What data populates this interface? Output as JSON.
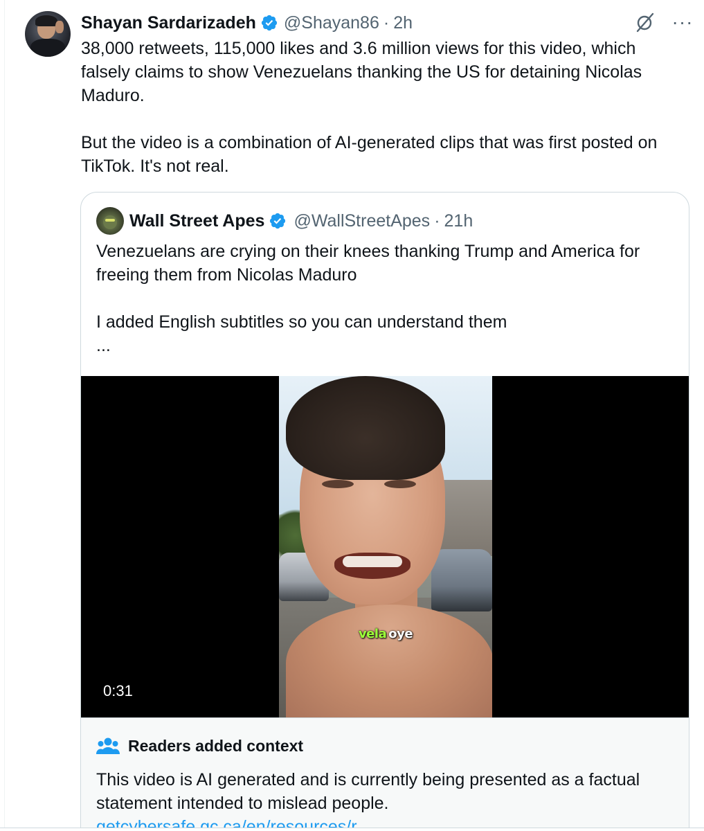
{
  "tweet": {
    "author_name": "Shayan Sardarizadeh",
    "handle": "@Shayan86",
    "separator": "·",
    "time": "2h",
    "paragraphs": [
      "38,000 retweets, 115,000 likes and 3.6 million views for this video, which falsely claims to show Venezuelans thanking the US for detaining Nicolas Maduro.",
      "But the video is a combination of AI-generated clips that was first posted on TikTok. It's not real."
    ],
    "more_label": "···",
    "icons": {
      "verified": "verified-badge-icon",
      "grok": "grok-icon",
      "more": "more-options-icon"
    }
  },
  "quote": {
    "author_name": "Wall Street Apes",
    "handle": "@WallStreetApes",
    "separator": "·",
    "time": "21h",
    "paragraphs": [
      "Venezuelans are crying on their knees thanking Trump and America for freeing them from Nicolas Maduro",
      "I added English subtitles so you can understand them"
    ],
    "ellipsis": "...",
    "video": {
      "duration": "0:31",
      "caption_word_1": "vela",
      "caption_word_2": "oye"
    },
    "community_note": {
      "title": "Readers added context",
      "text": "This video is AI generated and is currently being presented as a factual statement intended to mislead people.",
      "link": "getcybersafe.gc.ca/en/resources/r..."
    }
  },
  "colors": {
    "text_primary": "#0f1419",
    "text_secondary": "#536471",
    "verified_blue": "#1d9bf0",
    "link_blue": "#1d9bf0",
    "card_border": "#cfd9de",
    "context_bg": "#f7f9f9",
    "caption_green": "#9cff3a"
  }
}
